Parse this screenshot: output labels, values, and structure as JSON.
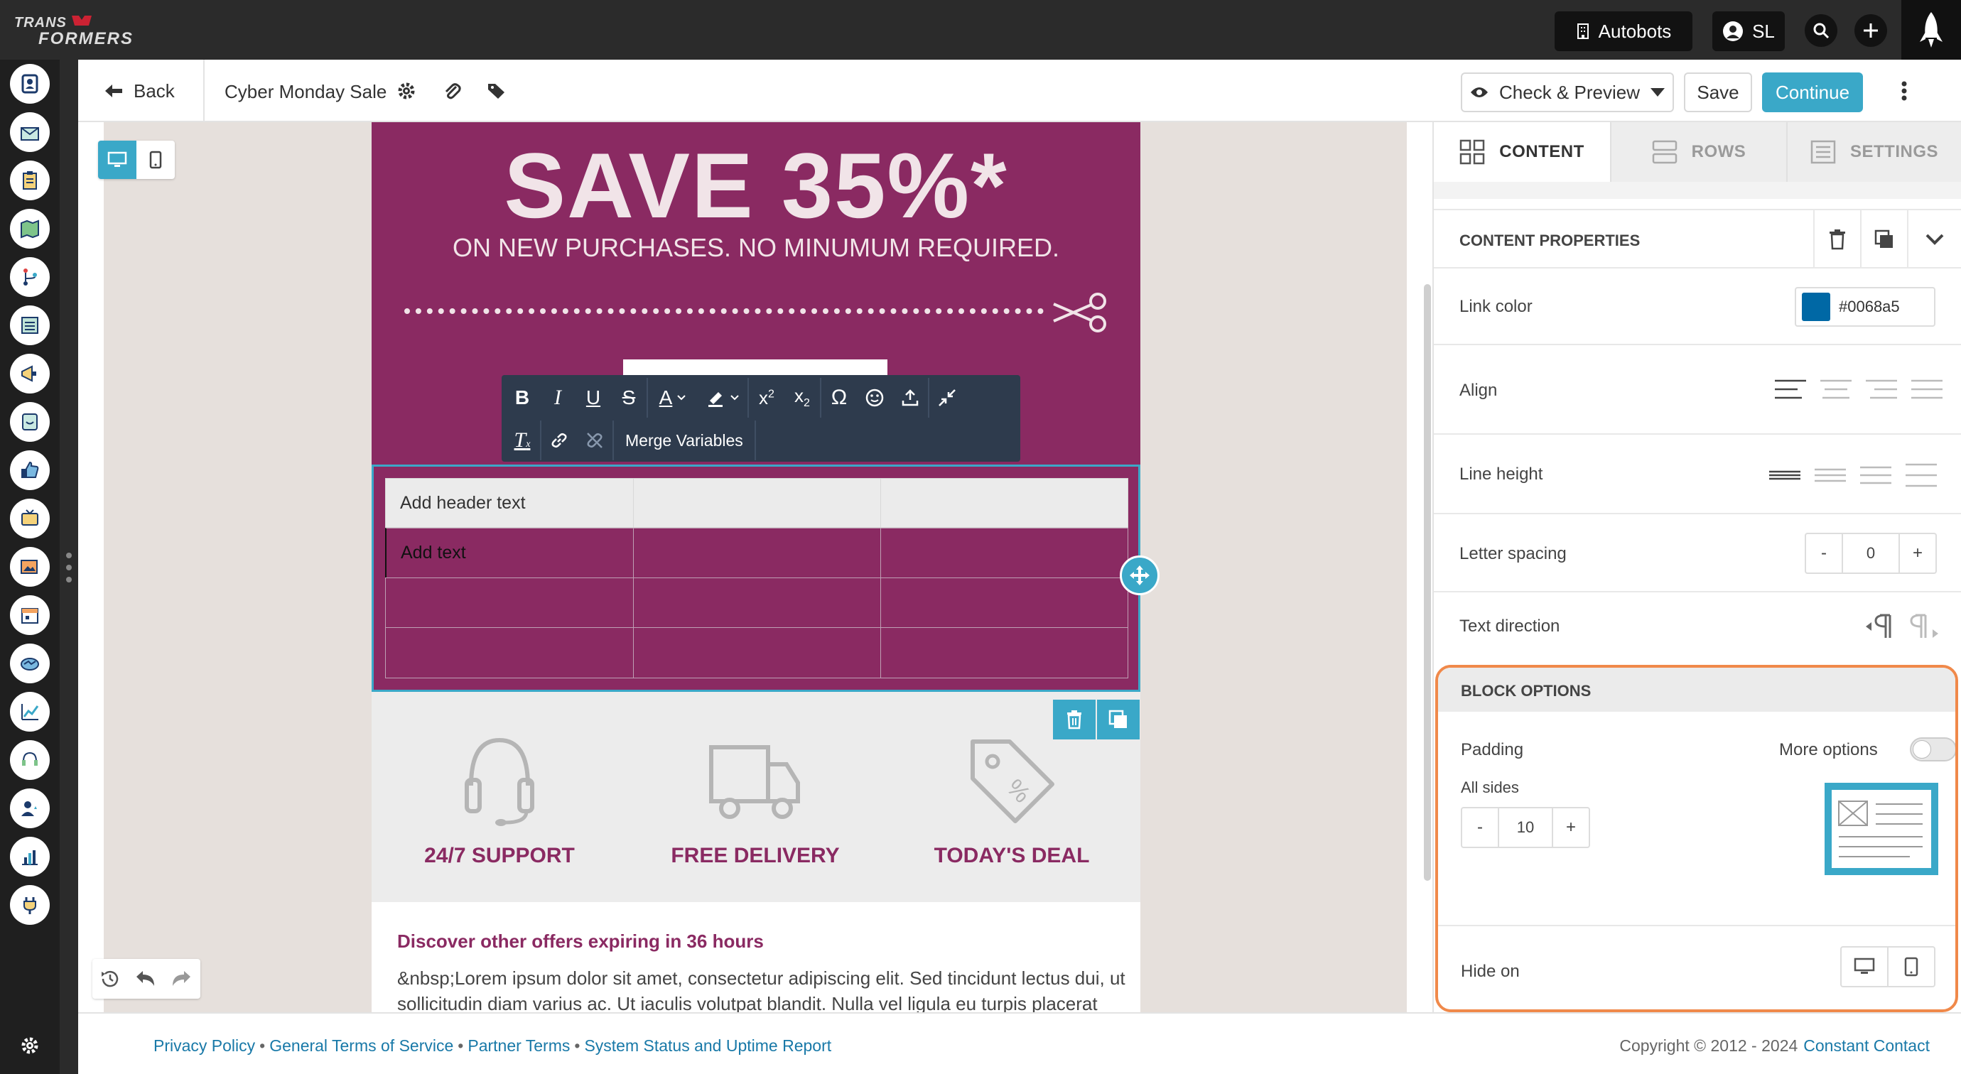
{
  "app": {
    "logo_text": "TRANSFORMERS",
    "account_label": "Autobots",
    "user_initials": "SL"
  },
  "editor": {
    "back_label": "Back",
    "campaign_name": "Cyber Monday Sale",
    "check_preview_label": "Check & Preview",
    "save_label": "Save",
    "continue_label": "Continue"
  },
  "email": {
    "headline": "SAVE 35%*",
    "subheadline": "ON NEW PURCHASES. NO MINUMUM REQUIRED.",
    "table": {
      "header_text": "Add header text",
      "body_text": "Add text"
    },
    "features": [
      {
        "label": "24/7 SUPPORT",
        "icon": "headset-icon"
      },
      {
        "label": "FREE DELIVERY",
        "icon": "truck-icon"
      },
      {
        "label": "TODAY'S DEAL",
        "icon": "price-tag-icon"
      }
    ],
    "offer_heading": "Discover other offers expiring in 36 hours",
    "offer_body_1": "&nbsp;Lorem ipsum dolor sit amet, consectetur adipiscing elit. Sed tincidunt lectus dui, ut",
    "offer_body_2": "sollicitudin diam varius ac. Ut iaculis volutpat blandit. Nulla vel ligula eu turpis placerat"
  },
  "toolbar": {
    "merge_variables_label": "Merge Variables"
  },
  "panel": {
    "tabs": [
      {
        "label": "CONTENT",
        "active": true
      },
      {
        "label": "ROWS",
        "active": false
      },
      {
        "label": "SETTINGS",
        "active": false
      }
    ],
    "content_properties_title": "CONTENT PROPERTIES",
    "link_color_label": "Link color",
    "link_color_value": "#0068a5",
    "align_label": "Align",
    "line_height_label": "Line height",
    "letter_spacing_label": "Letter spacing",
    "letter_spacing_value": "0",
    "text_direction_label": "Text direction",
    "block_options_title": "BLOCK OPTIONS",
    "padding_label": "Padding",
    "more_options_label": "More options",
    "all_sides_label": "All sides",
    "padding_value": "10",
    "hide_on_label": "Hide on",
    "minus": "-",
    "plus": "+"
  },
  "footer": {
    "links": [
      "Privacy Policy",
      "General Terms of Service",
      "Partner Terms",
      "System Status and Uptime Report"
    ],
    "copyright": "Copyright © 2012 - 2024",
    "brand_link": "Constant Contact"
  },
  "colors": {
    "brand_purple": "#8a2a62",
    "accent_teal": "#3aa8c8",
    "highlight_orange": "#f0894a",
    "link_swatch": "#0068a5"
  }
}
